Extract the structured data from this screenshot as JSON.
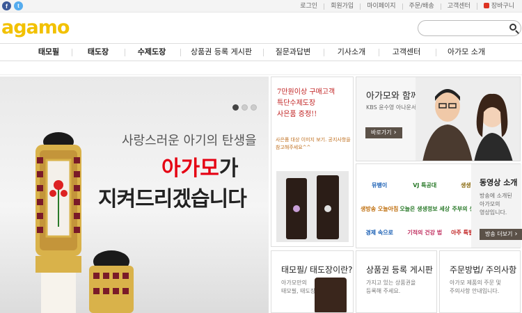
{
  "topbar": {
    "sns": [
      "f",
      "t"
    ],
    "links": [
      "로그인",
      "회원가입",
      "마이페이지",
      "주문/배송",
      "고객센터",
      "장바구니"
    ]
  },
  "header": {
    "logo": "agamo",
    "search_placeholder": ""
  },
  "nav": {
    "items": [
      "태모필",
      "태도장",
      "수제도장",
      "상품권 등록 게시판",
      "질문과답변",
      "기사소개",
      "고객센터",
      "아가모 소개"
    ]
  },
  "hero": {
    "line1": "사랑스러운 아기의 탄생을",
    "line2_red": "아가모",
    "line2_rest": "가",
    "line3": "지켜드리겠습니다",
    "slide_count": 3,
    "active_slide": 1
  },
  "promo": {
    "lines": [
      "7만원이상 구매고객",
      "특단수제도장",
      "사은품 증정!!"
    ],
    "sub": [
      "사은품 대상 이미지 보기. 공지사항을",
      "참고해주세요^^"
    ]
  },
  "celeb": {
    "title": "아가모와 함께한 분들",
    "subtitle": "KBS 윤수영 아나운서",
    "button": "바로가기"
  },
  "video": {
    "title": "동영상 소개",
    "desc": [
      "방송에 소개된",
      "아가모의",
      "영상입니다."
    ],
    "button": "방송 더보기",
    "logos": [
      "뮤뱅이",
      "VJ 특공대",
      "생생정보",
      "생방송 오늘아침",
      "오늘은 생생정보 세상",
      "주부의 생생정보",
      "경제 속으로",
      "기적의 건강 법",
      "아주 특별한 아침"
    ]
  },
  "cards": [
    {
      "title": "태모필/ 태도장이란?",
      "desc": [
        "아가모만의",
        "태모필, 태도장"
      ]
    },
    {
      "title": "상품권 등록 게시판",
      "desc": [
        "가지고 있는 상품권을",
        "등록해 주세요."
      ]
    },
    {
      "title": "주문방법/ 주의사항",
      "desc": [
        "아가모 제품의 주문 및",
        "주의사항 안내입니다."
      ]
    }
  ],
  "colors": {
    "logo": "#f2c100",
    "accent_red": "#e50012",
    "button_brown": "#5b5148",
    "facebook": "#3b5998",
    "twitter": "#55acee"
  }
}
